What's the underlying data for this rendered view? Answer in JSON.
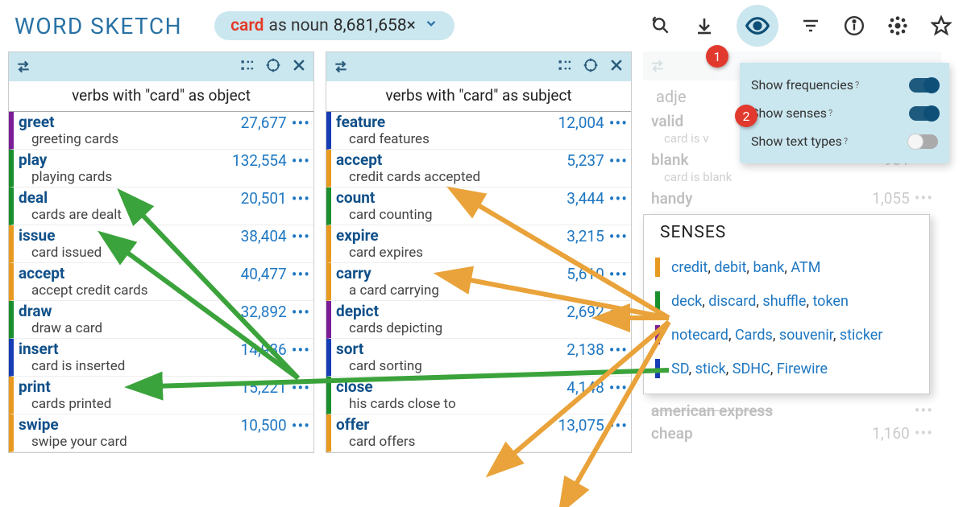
{
  "header": {
    "title": "WORD SKETCH",
    "lemma": "card",
    "pos_label": "as noun",
    "freq": "8,681,658×"
  },
  "sense_colors": {
    "orange": "#e79a1f",
    "green": "#1a8f2e",
    "purple": "#7a1d96",
    "blue": "#173db5"
  },
  "panels": [
    {
      "title": "verbs with \"card\" as object",
      "rows": [
        {
          "word": "greet",
          "example": "greeting cards",
          "freq": "27,677",
          "color": "purple"
        },
        {
          "word": "play",
          "example": "playing cards",
          "freq": "132,554",
          "color": "green"
        },
        {
          "word": "deal",
          "example": "cards are dealt",
          "freq": "20,501",
          "color": "green"
        },
        {
          "word": "issue",
          "example": "card issued",
          "freq": "38,404",
          "color": "orange"
        },
        {
          "word": "accept",
          "example": "accept credit cards",
          "freq": "40,477",
          "color": "orange"
        },
        {
          "word": "draw",
          "example": "draw a card",
          "freq": "32,892",
          "color": "green"
        },
        {
          "word": "insert",
          "example": "card is inserted",
          "freq": "14,986",
          "color": "blue"
        },
        {
          "word": "print",
          "example": "cards printed",
          "freq": "15,221",
          "color": "orange"
        },
        {
          "word": "swipe",
          "example": "swipe your card",
          "freq": "10,500",
          "color": "orange"
        }
      ]
    },
    {
      "title": "verbs with \"card\" as subject",
      "rows": [
        {
          "word": "feature",
          "example": "card features",
          "freq": "12,004",
          "color": "blue"
        },
        {
          "word": "accept",
          "example": "credit cards accepted",
          "freq": "5,237",
          "color": "orange"
        },
        {
          "word": "count",
          "example": "card counting",
          "freq": "3,444",
          "color": "green"
        },
        {
          "word": "expire",
          "example": "card expires",
          "freq": "3,215",
          "color": "orange"
        },
        {
          "word": "carry",
          "example": "a card carrying",
          "freq": "5,610",
          "color": "orange"
        },
        {
          "word": "depict",
          "example": "cards depicting",
          "freq": "2,692",
          "color": "purple"
        },
        {
          "word": "sort",
          "example": "card sorting",
          "freq": "2,138",
          "color": "blue"
        },
        {
          "word": "close",
          "example": "his cards close to",
          "freq": "4,148",
          "color": "green"
        },
        {
          "word": "offer",
          "example": "card offers",
          "freq": "13,075",
          "color": "orange"
        }
      ]
    }
  ],
  "adjectives": {
    "title": "adjectives",
    "rows": [
      {
        "word": "valid",
        "example": "card is v",
        "freq": ""
      },
      {
        "word": "blank",
        "example": "card is blank",
        "freq": "981"
      },
      {
        "word": "handy",
        "example": "",
        "freq": "1,055"
      },
      {
        "word": "american express",
        "example": "",
        "freq": "",
        "struck": true
      },
      {
        "word": "cheap",
        "example": "",
        "freq": "1,160"
      }
    ]
  },
  "senses": {
    "title": "SENSES",
    "rows": [
      {
        "color": "orange",
        "words": [
          "credit",
          "debit",
          "bank",
          "ATM"
        ]
      },
      {
        "color": "green",
        "words": [
          "deck",
          "discard",
          "shuffle",
          "token"
        ]
      },
      {
        "color": "purple",
        "words": [
          "notecard",
          "Cards",
          "souvenir",
          "sticker"
        ]
      },
      {
        "color": "blue",
        "words": [
          "SD",
          "stick",
          "SDHC",
          "Firewire"
        ]
      }
    ]
  },
  "options": [
    {
      "label": "Show frequencies",
      "on": true
    },
    {
      "label": "Show senses",
      "on": true
    },
    {
      "label": "Show text types",
      "on": false
    }
  ],
  "badges": {
    "one": "1",
    "two": "2"
  }
}
